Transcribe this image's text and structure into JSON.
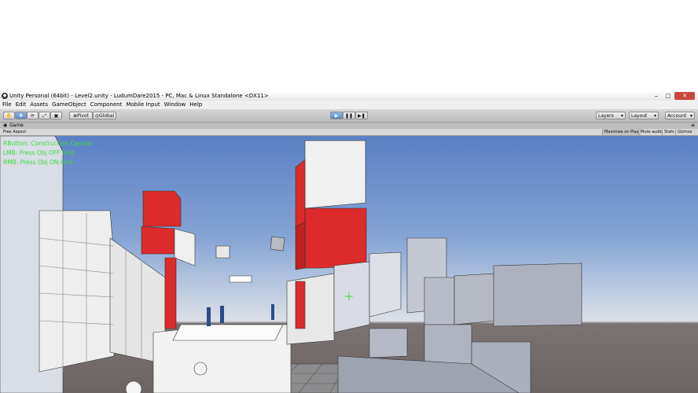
{
  "titlebar": {
    "title": "Unity Personal (64bit) - Level2.unity - LudumDare2015 - PC, Mac & Linux Standalone <DX11>",
    "minimize": "‒",
    "maximize": "□",
    "close": "✕"
  },
  "menu": [
    "File",
    "Edit",
    "Assets",
    "GameObject",
    "Component",
    "Mobile Input",
    "Window",
    "Help"
  ],
  "toolbar": {
    "pivot_label": "Pivot",
    "global_label": "Global",
    "layers_label": "Layers",
    "layout_label": "Layout",
    "account_label": "Account"
  },
  "game_tab": {
    "label": "Game",
    "aspect": "Free Aspect",
    "toggles": [
      "Maximize on Play",
      "Mute audio",
      "Stats",
      "Gizmos"
    ]
  },
  "overlay_lines": [
    "RButton: Construction Cannon",
    "LMB: Press Obj OFF Grid",
    "RMB: Press Obj ON Grid"
  ],
  "colors": {
    "accent_red": "#dd2a2a",
    "overlay_green": "#3fdc3f"
  }
}
